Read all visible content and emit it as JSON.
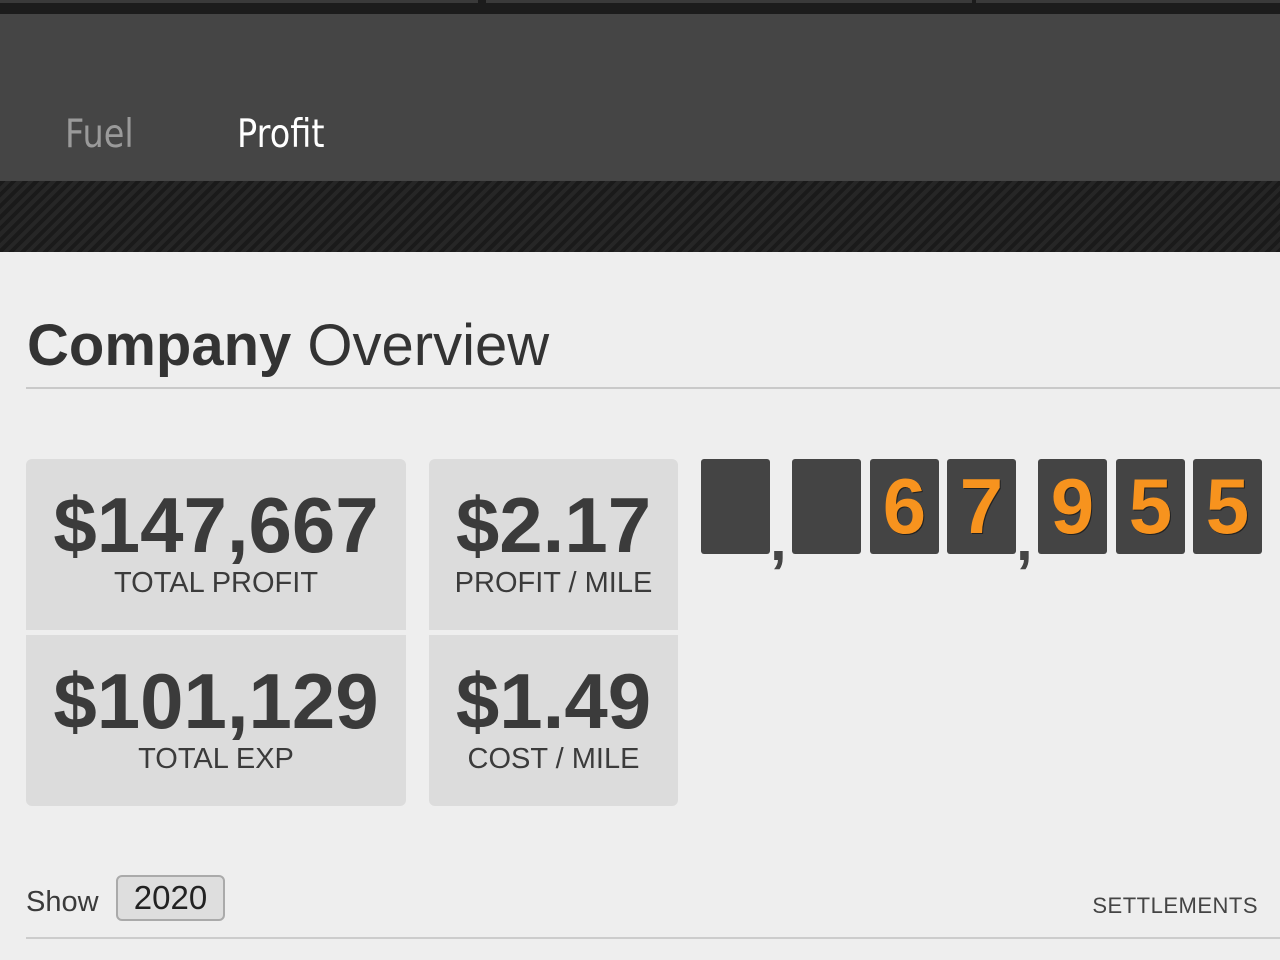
{
  "nav": {
    "tabs": [
      {
        "label": "Fuel",
        "active": false
      },
      {
        "label": "Profit",
        "active": true
      }
    ]
  },
  "overview": {
    "title_bold": "Company",
    "title_light": "Overview"
  },
  "stats": {
    "total_profit": {
      "value": "$147,667",
      "label": "TOTAL PROFIT"
    },
    "profit_per_mile": {
      "value": "$2.17",
      "label": "PROFIT / MILE"
    },
    "total_exp": {
      "value": "$101,129",
      "label": "TOTAL EXP"
    },
    "cost_per_mile": {
      "value": "$1.49",
      "label": "COST / MILE"
    }
  },
  "odometer": {
    "digits": [
      "",
      "",
      "6",
      "7",
      "9",
      "5",
      "5"
    ],
    "separator": ",",
    "digit_color": "#f7931e",
    "tile_color": "#444444"
  },
  "filter": {
    "show_label": "Show",
    "year": "2020",
    "settlements_link": "SETTLEMENTS"
  },
  "colors": {
    "nav_bg": "#454545",
    "accent": "#f7931e",
    "card_bg": "#dcdcdc",
    "page_bg": "#eeeeee"
  }
}
